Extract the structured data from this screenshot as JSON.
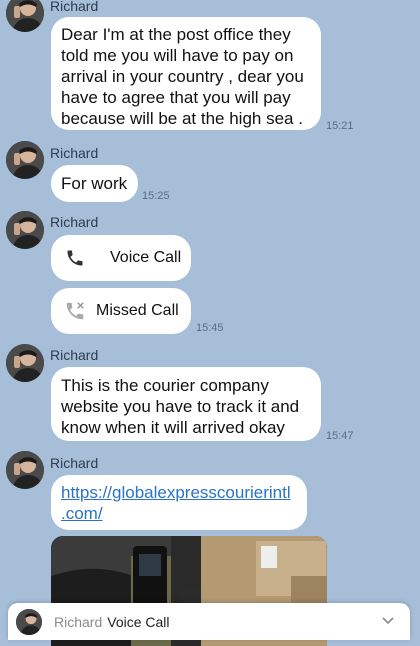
{
  "sender_name": "Richard",
  "messages": [
    {
      "text_lines": [
        "Dear I'm at the post  office  they",
        "told  me you will have to pay on",
        "arrival  in your  country , dear you",
        "have to agree  that you will pay",
        "because  will be at the high  sea ."
      ],
      "time": "15:21"
    },
    {
      "text_lines": [
        "For work"
      ],
      "time": "15:25"
    },
    {
      "call_label": "Voice Call"
    },
    {
      "call_label": "Missed Call",
      "time": "15:45"
    },
    {
      "text_lines": [
        "This is  the courier company",
        "website  you have to track  it and",
        "know  when it will  arrived  okay"
      ],
      "time": "15:47"
    },
    {
      "link_lines": [
        "https://globalexpresscourierintl",
        ".com/"
      ]
    }
  ],
  "notification": {
    "name": "Richard",
    "message": "Voice Call"
  },
  "icons": {
    "avatar": "profile-photo",
    "voice_call": "phone-icon",
    "missed_call": "missed-call-icon",
    "chevron": "chevron-down-icon"
  },
  "colors": {
    "background": "#a6bed8",
    "bubble": "#ffffff",
    "link": "#2a73c7",
    "time": "#5a6e83"
  }
}
